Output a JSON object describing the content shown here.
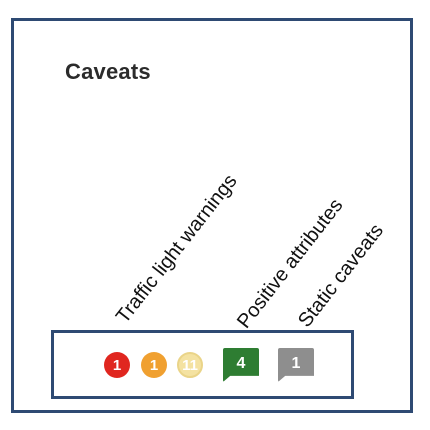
{
  "panel": {
    "title": "Caveats"
  },
  "column_headers": {
    "traffic": "Traffic light warnings",
    "positive": "Positive attributes",
    "static": "Static caveats"
  },
  "badges": {
    "red_count": "1",
    "amber_count": "1",
    "yellow_count": "11",
    "positive_count": "4",
    "static_count": "1"
  },
  "colors": {
    "frame": "#2e4a73",
    "red": "#e0261f",
    "amber": "#f0a030",
    "yellow": "#f4e2a1",
    "positive": "#2e7d32",
    "static": "#8e8e8e"
  },
  "icons": {
    "red": "red-warning-circle-icon",
    "amber": "amber-warning-circle-icon",
    "yellow": "yellow-warning-circle-icon",
    "positive": "speech-tag-icon",
    "static": "speech-tag-icon"
  }
}
